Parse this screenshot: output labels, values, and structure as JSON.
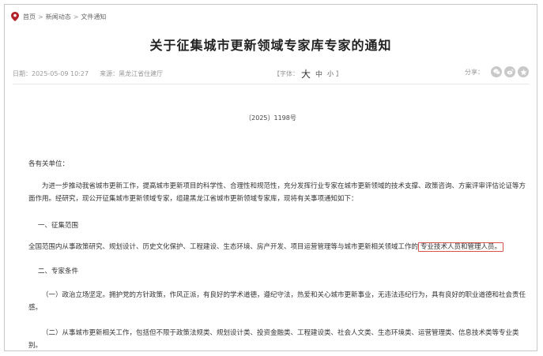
{
  "breadcrumb": {
    "home": "首页",
    "section": "新闻动态",
    "current": "文件通知",
    "separator": ">"
  },
  "article": {
    "title": "关于征集城市更新领域专家库专家的通知",
    "meta": {
      "date": "日期：2025-05-09 10:27",
      "source": "来源：黑龙江省住建厅"
    },
    "font_size": {
      "open": "【",
      "label": "字体：",
      "large": "大",
      "medium": "中",
      "small": "小",
      "close": "】"
    },
    "share_label": "分享：",
    "doc_number": "〔2025〕1198号",
    "addressee": "各有关单位：",
    "intro": "为进一步推动我省城市更新工作，提高城市更新项目的科学性、合理性和规范性，充分发挥行业专家在城市更新领域的技术支撑、政策咨询、方案评审评估论证等方面作用。经研究，现公开征集城市更新领域专家，组建黑龙江省城市更新领域专家库，现将有关事项通知如下：",
    "section1_heading": "一、征集范围",
    "scope_text": "全国范围内从事政策研究、规划设计、历史文化保护、工程建设、生态环境、房产开发、项目运营管理等与城市更新相关领域工作的",
    "scope_highlight": "专业技术人员和管理人员。",
    "section2_heading": "二、专家条件",
    "cond1": "（一）政治立场坚定。拥护党的方针政策，作风正派，有良好的学术道德，遵纪守法，热爱和关心城市更新事业，无违法违纪行为，具有良好的职业道德和社会责任感。",
    "cond2": "（二）从事城市更新相关工作，包括但不限于政策法规类、规划设计类、投资金融类、工程建设类、社会人文类、生态环境类、运营管理类、信息技术类等专业类别。"
  },
  "colors": {
    "pin_icon": "#b2242a",
    "highlight_border": "#d9534f",
    "share_icon_bg": "#c9c9c9"
  },
  "icons": {
    "location": "location-pin-icon",
    "share": [
      "wechat-icon",
      "weibo-icon",
      "qzone-icon"
    ]
  }
}
